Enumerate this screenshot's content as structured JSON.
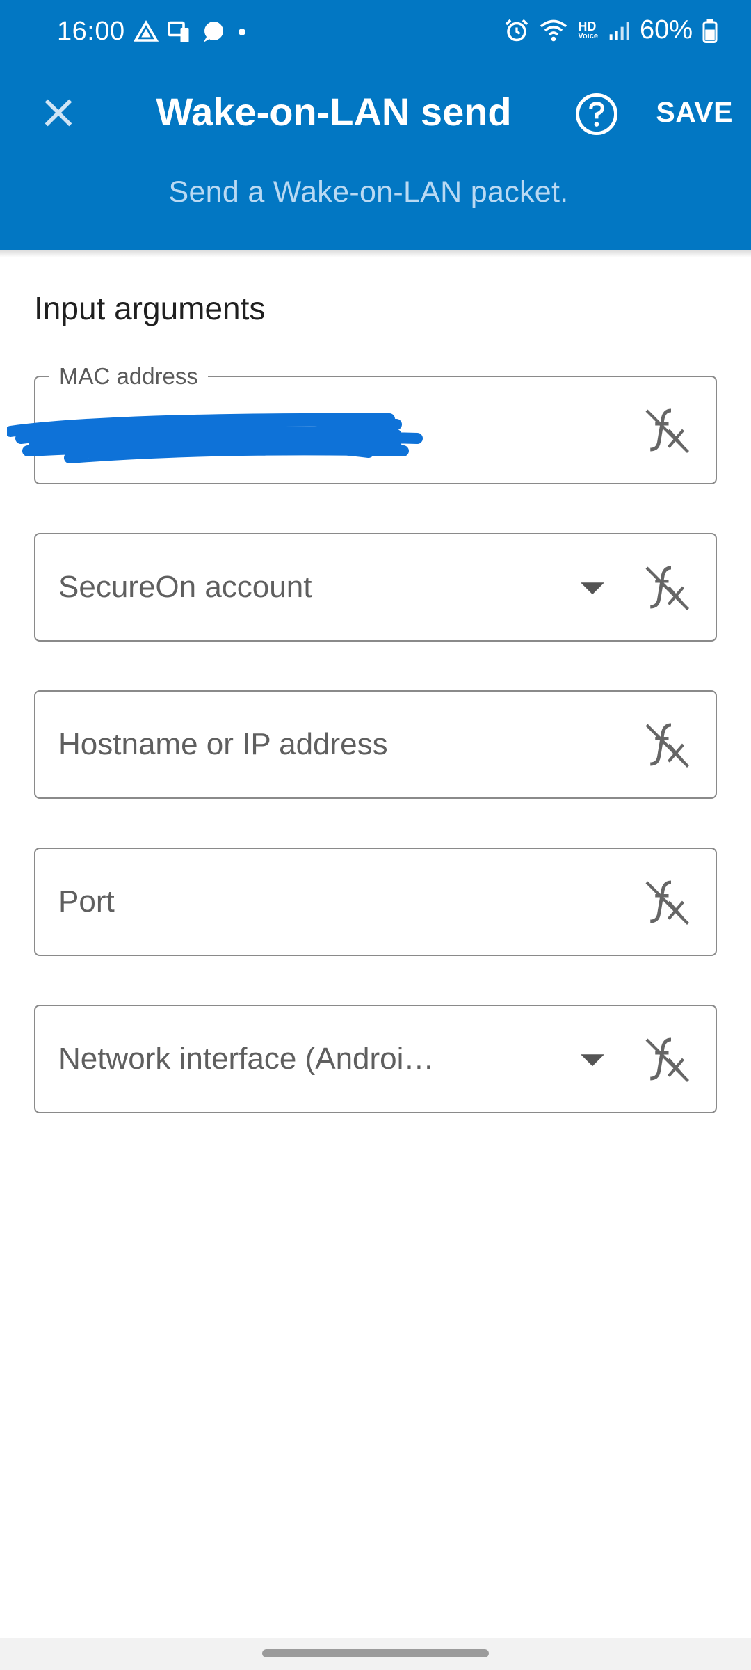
{
  "status_bar": {
    "time": "16:00",
    "battery": "60%",
    "hd_label": "HD",
    "voice_label": "Voice"
  },
  "app_bar": {
    "title": "Wake-on-LAN send",
    "subtitle": "Send a Wake-on-LAN packet.",
    "save_label": "SAVE",
    "background": "#0277c3"
  },
  "form": {
    "section_title": "Input arguments",
    "fields": [
      {
        "label": "MAC address",
        "value": "",
        "dropdown": false
      },
      {
        "label": "SecureOn account",
        "dropdown": true
      },
      {
        "label": "Hostname or IP address",
        "dropdown": false
      },
      {
        "label": "Port",
        "dropdown": false
      },
      {
        "label": "Network interface (Androi…",
        "dropdown": true
      }
    ]
  },
  "icons": {
    "close": "close-icon",
    "help": "help-icon",
    "function": "fx-icon",
    "dropdown": "dropdown-arrow-icon"
  }
}
